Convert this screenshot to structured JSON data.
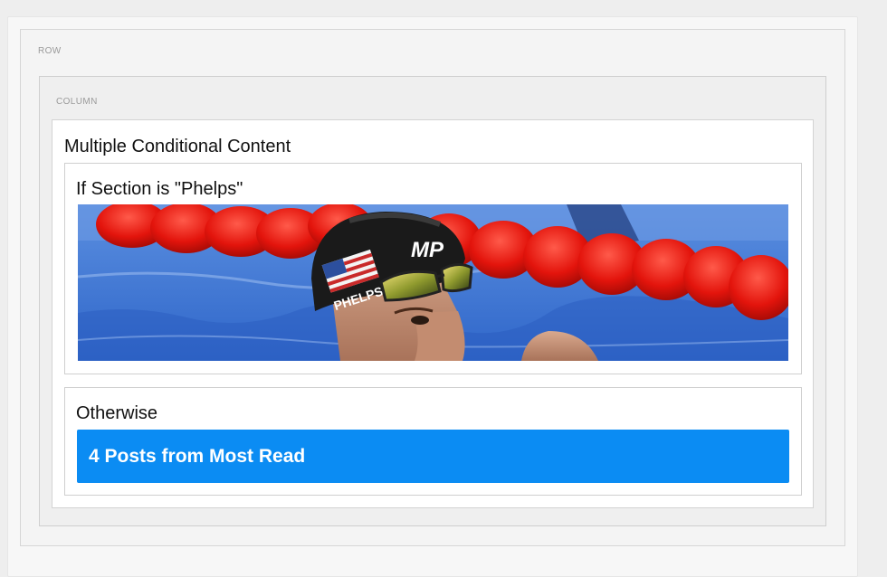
{
  "builder": {
    "row_label": "ROW",
    "column_label": "COLUMN"
  },
  "module": {
    "title": "Multiple Conditional Content"
  },
  "conditions": [
    {
      "title": "If Section is \"Phelps\"",
      "content_type": "image",
      "image_description": "swimmer-photo",
      "cap_text": "PHELPS"
    },
    {
      "title": "Otherwise",
      "content_type": "post-list",
      "label": "4 Posts from Most Read"
    }
  ],
  "colors": {
    "accent": "#0b8cf3",
    "page_bg": "#eeeeee"
  }
}
